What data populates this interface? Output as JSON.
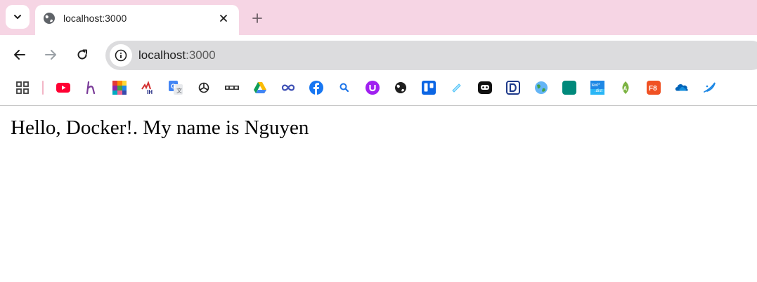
{
  "browser": {
    "tab": {
      "title": "localhost:3000"
    },
    "address": {
      "host": "localhost",
      "port": ":3000"
    }
  },
  "bookmarks": [
    {
      "icon": "apps-grid-icon"
    },
    {
      "icon": "youtube-icon"
    },
    {
      "icon": "h-logo-icon"
    },
    {
      "icon": "color-grid-icon"
    },
    {
      "icon": "ih-logo-icon"
    },
    {
      "icon": "google-translate-icon"
    },
    {
      "icon": "chatgpt-icon"
    },
    {
      "icon": "bar-logo-icon"
    },
    {
      "icon": "google-drive-icon"
    },
    {
      "icon": "link-loop-icon"
    },
    {
      "icon": "facebook-icon"
    },
    {
      "icon": "search-magnifier-icon"
    },
    {
      "icon": "u-logo-icon"
    },
    {
      "icon": "globe-dark-icon"
    },
    {
      "icon": "trello-icon"
    },
    {
      "icon": "pencil-icon"
    },
    {
      "icon": "robot-icon"
    },
    {
      "icon": "d-logo-icon"
    },
    {
      "icon": "globe-color-icon"
    },
    {
      "icon": "teal-square-icon"
    },
    {
      "icon": "text-dist-icon"
    },
    {
      "icon": "green-a-icon"
    },
    {
      "icon": "f8-icon"
    },
    {
      "icon": "onedrive-icon"
    },
    {
      "icon": "swoosh-icon"
    }
  ],
  "page": {
    "text": "Hello, Docker!. My name is Nguyen"
  },
  "colors": {
    "tabstrip": "#f6d5e4",
    "omnibox": "#dcdcde",
    "youtube": "#ff0033",
    "facebook": "#1877f2",
    "trello": "#0c66e4"
  }
}
